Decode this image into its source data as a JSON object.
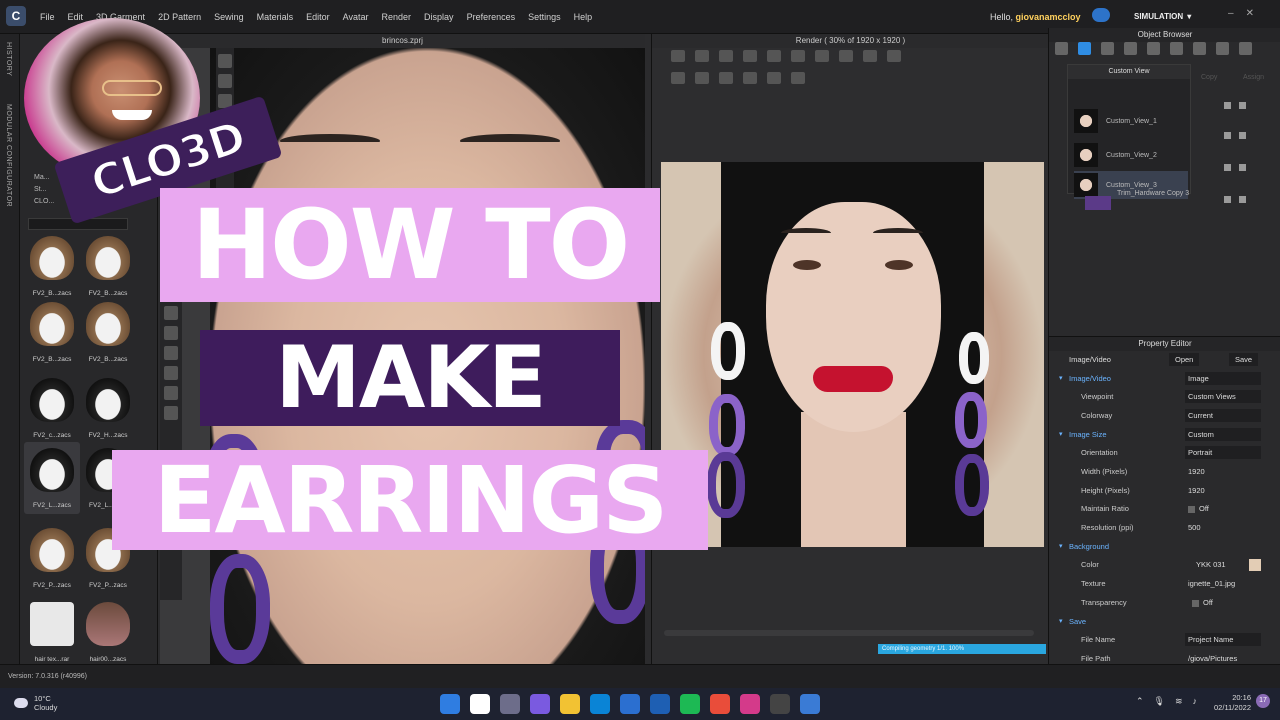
{
  "menubar": {
    "logo_letter": "C",
    "items": [
      "File",
      "Edit",
      "3D Garment",
      "2D Pattern",
      "Sewing",
      "Materials",
      "Editor",
      "Avatar",
      "Render",
      "Display",
      "Preferences",
      "Settings",
      "Help"
    ],
    "greeting": "Hello,",
    "username": "giovanamccloy",
    "mode": "SIMULATION"
  },
  "side_tabs": {
    "history": "HISTORY",
    "modular": "MODULAR CONFIGURATOR"
  },
  "library": {
    "tree": [
      "Ma...",
      "St...",
      "CLO..."
    ],
    "items": [
      {
        "label": "FV2_B...zacs"
      },
      {
        "label": "FV2_B...zacs"
      },
      {
        "label": "FV2_B...zacs"
      },
      {
        "label": "FV2_B...zacs"
      },
      {
        "label": "FV2_c...zacs"
      },
      {
        "label": "FV2_H...zacs"
      },
      {
        "label": "FV2_L...zacs"
      },
      {
        "label": "FV2_L...zacs"
      },
      {
        "label": "FV2_P...zacs"
      },
      {
        "label": "FV2_P...zacs"
      },
      {
        "label": "hair tex...rar"
      },
      {
        "label": "hair00...zacs"
      }
    ]
  },
  "viewport_3d": {
    "title": "brincos.zprj"
  },
  "render_view": {
    "title": "Render ( 30% of 1920 x 1920 )",
    "status": "Compiling geometry 1/1. 100%"
  },
  "object_browser": {
    "title": "Object Browser",
    "custom_view_title": "Custom View",
    "views": [
      "Custom_View_1",
      "Custom_View_2",
      "Custom_View_3"
    ],
    "copy_label": "Copy",
    "assign_label": "Assign",
    "trim_label": "Trim_Hardware Copy 3"
  },
  "property_editor": {
    "title": "Property Editor",
    "header_label": "Image/Video",
    "open_label": "Open",
    "save_label": "Save",
    "rows": {
      "image_video_section": "Image/Video",
      "image_video_value": "Image",
      "viewpoint_key": "Viewpoint",
      "viewpoint_value": "Custom Views",
      "colorway_key": "Colorway",
      "colorway_value": "Current",
      "image_size_section": "Image Size",
      "image_size_value": "Custom",
      "orientation_key": "Orientation",
      "orientation_value": "Portrait",
      "width_key": "Width (Pixels)",
      "width_value": "1920",
      "height_key": "Height (Pixels)",
      "height_value": "1920",
      "ratio_key": "Maintain Ratio",
      "ratio_value": "Off",
      "resolution_key": "Resolution (ppi)",
      "resolution_value": "500",
      "background_section": "Background",
      "color_key": "Color",
      "color_value": "YKK 031",
      "texture_key": "Texture",
      "texture_value": "ignette_01.jpg",
      "transparency_key": "Transparency",
      "transparency_value": "Off",
      "save_section": "Save",
      "filename_key": "File Name",
      "filename_value": "Project Name",
      "filepath_key": "File Path",
      "filepath_value": "/giova/Pictures"
    }
  },
  "version": "Version: 7.0.316 (r40996)",
  "taskbar": {
    "temp": "10°C",
    "weather": "Cloudy",
    "time": "20:16",
    "date": "02/11/2022",
    "notifications": "17",
    "app_colors": [
      "#2f7de1",
      "#ffffff",
      "#6d6d8a",
      "#7a5ae0",
      "#f2c233",
      "#0a84d6",
      "#2b6fd0",
      "#1e5fb3",
      "#1db954",
      "#e94d3a",
      "#d43a8a",
      "#444444",
      "#3a7bd5"
    ]
  },
  "thumbnail_overlay": {
    "brand": "CLO3D",
    "line1": "HOW TO",
    "line2": "MAKE",
    "line3": "EARRINGS"
  },
  "colors": {
    "accent": "#2f8de4",
    "highlight": "#e9a8f0",
    "purple": "#3e1c5c"
  }
}
